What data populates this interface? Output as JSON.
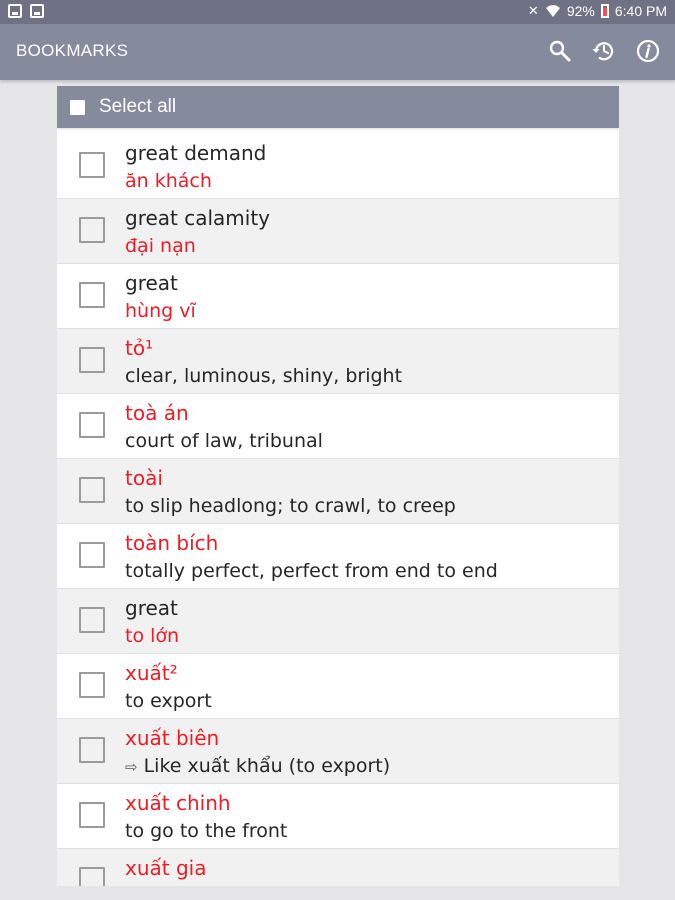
{
  "status_bar": {
    "battery": "92%",
    "time": "6:40 PM"
  },
  "app_bar": {
    "title": "BOOKMARKS",
    "icons": [
      "search-icon",
      "history-icon",
      "info-icon"
    ]
  },
  "select_all": {
    "label": "Select all"
  },
  "colors": {
    "accent_bar": "#868a9d",
    "status_bar": "#6f7285",
    "headword": "#ee1c24",
    "text": "#262626"
  },
  "bookmarks": [
    {
      "line1": "great demand",
      "line2": "ăn khách",
      "line1_color": "dark",
      "line2_color": "red",
      "shade": false
    },
    {
      "line1": "great calamity",
      "line2": "đại nạn",
      "line1_color": "dark",
      "line2_color": "red",
      "shade": true
    },
    {
      "line1": "great",
      "line2": "hùng vĩ",
      "line1_color": "dark",
      "line2_color": "red",
      "shade": false
    },
    {
      "line1": "tỏ¹",
      "line2": "clear, luminous, shiny, bright",
      "line1_color": "red",
      "line2_color": "dark",
      "shade": true
    },
    {
      "line1": "toà án",
      "line2": "court of law, tribunal",
      "line1_color": "red",
      "line2_color": "dark",
      "shade": false
    },
    {
      "line1": "toài",
      "line2": "to slip headlong; to crawl, to creep",
      "line1_color": "red",
      "line2_color": "dark",
      "shade": true
    },
    {
      "line1": "toàn bích",
      "line2": "totally perfect, perfect from end to end",
      "line1_color": "red",
      "line2_color": "dark",
      "shade": false
    },
    {
      "line1": "great",
      "line2": "to lớn",
      "line1_color": "dark",
      "line2_color": "red",
      "shade": true
    },
    {
      "line1": "xuất²",
      "line2": "to export",
      "line1_color": "red",
      "line2_color": "dark",
      "shade": false
    },
    {
      "line1": "xuất biên",
      "line2": "Like xuất khẩu (to export)",
      "line2_prefix": "⇨",
      "line1_color": "red",
      "line2_color": "dark",
      "shade": true
    },
    {
      "line1": "xuất chinh",
      "line2": "to go to the front",
      "line1_color": "red",
      "line2_color": "dark",
      "shade": false
    },
    {
      "line1": "xuất gia",
      "line2": "",
      "line1_color": "red",
      "line2_color": "dark",
      "shade": true
    }
  ]
}
